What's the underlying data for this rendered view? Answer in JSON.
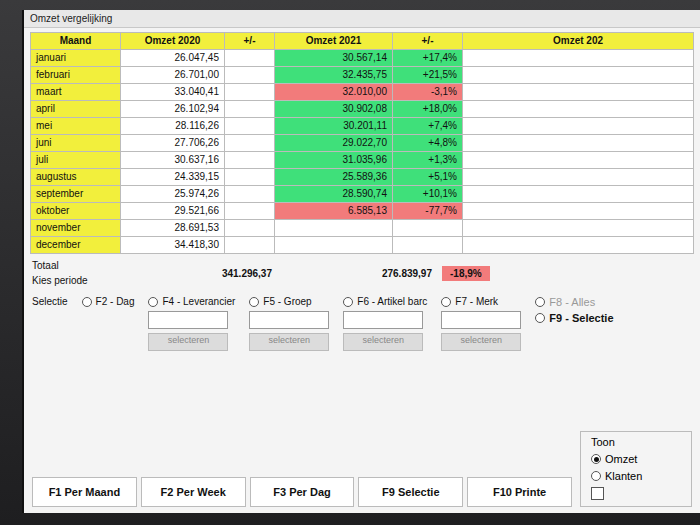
{
  "window": {
    "title": "Omzet vergelijking"
  },
  "table": {
    "columns": [
      "Maand",
      "Omzet 2020",
      "+/-",
      "Omzet 2021",
      "+/-",
      "Omzet 202"
    ],
    "rows": [
      {
        "month": "januari",
        "omzet_2020": "26.047,45",
        "diff_2020": "",
        "omzet_2021": "30.567,14",
        "diff_2021": "+17,4%",
        "color": "#3fe07a"
      },
      {
        "month": "februari",
        "omzet_2020": "26.701,00",
        "diff_2020": "",
        "omzet_2021": "32.435,75",
        "diff_2021": "+21,5%",
        "color": "#3fe07a"
      },
      {
        "month": "maart",
        "omzet_2020": "33.040,41",
        "diff_2020": "",
        "omzet_2021": "32.010,00",
        "diff_2021": "-3,1%",
        "color": "#f27b7b"
      },
      {
        "month": "april",
        "omzet_2020": "26.102,94",
        "diff_2020": "",
        "omzet_2021": "30.902,08",
        "diff_2021": "+18,0%",
        "color": "#3fe07a"
      },
      {
        "month": "mei",
        "omzet_2020": "28.116,26",
        "diff_2020": "",
        "omzet_2021": "30.201,11",
        "diff_2021": "+7,4%",
        "color": "#3fe07a"
      },
      {
        "month": "juni",
        "omzet_2020": "27.706,26",
        "diff_2020": "",
        "omzet_2021": "29.022,70",
        "diff_2021": "+4,8%",
        "color": "#3fe07a"
      },
      {
        "month": "juli",
        "omzet_2020": "30.637,16",
        "diff_2020": "",
        "omzet_2021": "31.035,96",
        "diff_2021": "+1,3%",
        "color": "#3fe07a"
      },
      {
        "month": "augustus",
        "omzet_2020": "24.339,15",
        "diff_2020": "",
        "omzet_2021": "25.589,36",
        "diff_2021": "+5,1%",
        "color": "#3fe07a"
      },
      {
        "month": "september",
        "omzet_2020": "25.974,26",
        "diff_2020": "",
        "omzet_2021": "28.590,74",
        "diff_2021": "+10,1%",
        "color": "#3fe07a"
      },
      {
        "month": "oktober",
        "omzet_2020": "29.521,66",
        "diff_2020": "",
        "omzet_2021": "6.585,13",
        "diff_2021": "-77,7%",
        "color": "#f27b7b"
      },
      {
        "month": "november",
        "omzet_2020": "28.691,53",
        "diff_2020": "",
        "omzet_2021": "",
        "diff_2021": "",
        "color": "#ffffff"
      },
      {
        "month": "december",
        "omzet_2020": "34.418,30",
        "diff_2020": "",
        "omzet_2021": "",
        "diff_2021": "",
        "color": "#ffffff"
      }
    ]
  },
  "totals": {
    "label": "Totaal",
    "period_label": "Kies periode",
    "omzet_2020": "341.296,37",
    "omzet_2021": "276.839,97",
    "diff_2021": "-18,9%",
    "color": "#f27b7b"
  },
  "selection": {
    "label": "Selectie",
    "options": [
      {
        "label": "F2 - Dag",
        "selected": false,
        "button": ""
      },
      {
        "label": "F4 - Leverancier",
        "selected": false,
        "button": "selecteren"
      },
      {
        "label": "F5 - Groep",
        "selected": false,
        "button": "selecteren"
      },
      {
        "label": "F6 - Artikel barc",
        "selected": false,
        "button": "selecteren"
      },
      {
        "label": "F7 - Merk",
        "selected": false,
        "button": "selecteren"
      }
    ],
    "scope": [
      {
        "label": "F8 - Alles",
        "selected": false,
        "disabled": true
      },
      {
        "label": "F9 - Selectie",
        "selected": false,
        "disabled": false
      }
    ]
  },
  "tabs": [
    "F1 Per Maand",
    "F2 Per Week",
    "F3 Per Dag",
    "F9 Selectie",
    "F10 Printe"
  ],
  "toon": {
    "title": "Toon",
    "options": [
      {
        "label": "Omzet",
        "selected": true
      },
      {
        "label": "Klanten",
        "selected": false
      }
    ]
  },
  "extra_checkbox": {
    "checked": false
  }
}
